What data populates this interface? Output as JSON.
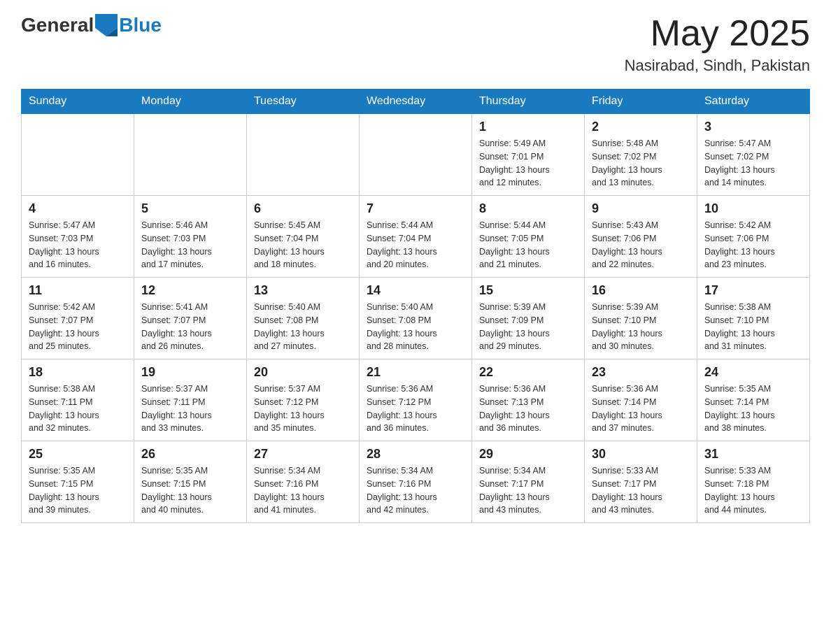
{
  "header": {
    "logo_general": "General",
    "logo_blue": "Blue",
    "title": "May 2025",
    "subtitle": "Nasirabad, Sindh, Pakistan"
  },
  "days_of_week": [
    "Sunday",
    "Monday",
    "Tuesday",
    "Wednesday",
    "Thursday",
    "Friday",
    "Saturday"
  ],
  "weeks": [
    [
      {
        "day": "",
        "info": ""
      },
      {
        "day": "",
        "info": ""
      },
      {
        "day": "",
        "info": ""
      },
      {
        "day": "",
        "info": ""
      },
      {
        "day": "1",
        "info": "Sunrise: 5:49 AM\nSunset: 7:01 PM\nDaylight: 13 hours\nand 12 minutes."
      },
      {
        "day": "2",
        "info": "Sunrise: 5:48 AM\nSunset: 7:02 PM\nDaylight: 13 hours\nand 13 minutes."
      },
      {
        "day": "3",
        "info": "Sunrise: 5:47 AM\nSunset: 7:02 PM\nDaylight: 13 hours\nand 14 minutes."
      }
    ],
    [
      {
        "day": "4",
        "info": "Sunrise: 5:47 AM\nSunset: 7:03 PM\nDaylight: 13 hours\nand 16 minutes."
      },
      {
        "day": "5",
        "info": "Sunrise: 5:46 AM\nSunset: 7:03 PM\nDaylight: 13 hours\nand 17 minutes."
      },
      {
        "day": "6",
        "info": "Sunrise: 5:45 AM\nSunset: 7:04 PM\nDaylight: 13 hours\nand 18 minutes."
      },
      {
        "day": "7",
        "info": "Sunrise: 5:44 AM\nSunset: 7:04 PM\nDaylight: 13 hours\nand 20 minutes."
      },
      {
        "day": "8",
        "info": "Sunrise: 5:44 AM\nSunset: 7:05 PM\nDaylight: 13 hours\nand 21 minutes."
      },
      {
        "day": "9",
        "info": "Sunrise: 5:43 AM\nSunset: 7:06 PM\nDaylight: 13 hours\nand 22 minutes."
      },
      {
        "day": "10",
        "info": "Sunrise: 5:42 AM\nSunset: 7:06 PM\nDaylight: 13 hours\nand 23 minutes."
      }
    ],
    [
      {
        "day": "11",
        "info": "Sunrise: 5:42 AM\nSunset: 7:07 PM\nDaylight: 13 hours\nand 25 minutes."
      },
      {
        "day": "12",
        "info": "Sunrise: 5:41 AM\nSunset: 7:07 PM\nDaylight: 13 hours\nand 26 minutes."
      },
      {
        "day": "13",
        "info": "Sunrise: 5:40 AM\nSunset: 7:08 PM\nDaylight: 13 hours\nand 27 minutes."
      },
      {
        "day": "14",
        "info": "Sunrise: 5:40 AM\nSunset: 7:08 PM\nDaylight: 13 hours\nand 28 minutes."
      },
      {
        "day": "15",
        "info": "Sunrise: 5:39 AM\nSunset: 7:09 PM\nDaylight: 13 hours\nand 29 minutes."
      },
      {
        "day": "16",
        "info": "Sunrise: 5:39 AM\nSunset: 7:10 PM\nDaylight: 13 hours\nand 30 minutes."
      },
      {
        "day": "17",
        "info": "Sunrise: 5:38 AM\nSunset: 7:10 PM\nDaylight: 13 hours\nand 31 minutes."
      }
    ],
    [
      {
        "day": "18",
        "info": "Sunrise: 5:38 AM\nSunset: 7:11 PM\nDaylight: 13 hours\nand 32 minutes."
      },
      {
        "day": "19",
        "info": "Sunrise: 5:37 AM\nSunset: 7:11 PM\nDaylight: 13 hours\nand 33 minutes."
      },
      {
        "day": "20",
        "info": "Sunrise: 5:37 AM\nSunset: 7:12 PM\nDaylight: 13 hours\nand 35 minutes."
      },
      {
        "day": "21",
        "info": "Sunrise: 5:36 AM\nSunset: 7:12 PM\nDaylight: 13 hours\nand 36 minutes."
      },
      {
        "day": "22",
        "info": "Sunrise: 5:36 AM\nSunset: 7:13 PM\nDaylight: 13 hours\nand 36 minutes."
      },
      {
        "day": "23",
        "info": "Sunrise: 5:36 AM\nSunset: 7:14 PM\nDaylight: 13 hours\nand 37 minutes."
      },
      {
        "day": "24",
        "info": "Sunrise: 5:35 AM\nSunset: 7:14 PM\nDaylight: 13 hours\nand 38 minutes."
      }
    ],
    [
      {
        "day": "25",
        "info": "Sunrise: 5:35 AM\nSunset: 7:15 PM\nDaylight: 13 hours\nand 39 minutes."
      },
      {
        "day": "26",
        "info": "Sunrise: 5:35 AM\nSunset: 7:15 PM\nDaylight: 13 hours\nand 40 minutes."
      },
      {
        "day": "27",
        "info": "Sunrise: 5:34 AM\nSunset: 7:16 PM\nDaylight: 13 hours\nand 41 minutes."
      },
      {
        "day": "28",
        "info": "Sunrise: 5:34 AM\nSunset: 7:16 PM\nDaylight: 13 hours\nand 42 minutes."
      },
      {
        "day": "29",
        "info": "Sunrise: 5:34 AM\nSunset: 7:17 PM\nDaylight: 13 hours\nand 43 minutes."
      },
      {
        "day": "30",
        "info": "Sunrise: 5:33 AM\nSunset: 7:17 PM\nDaylight: 13 hours\nand 43 minutes."
      },
      {
        "day": "31",
        "info": "Sunrise: 5:33 AM\nSunset: 7:18 PM\nDaylight: 13 hours\nand 44 minutes."
      }
    ]
  ]
}
